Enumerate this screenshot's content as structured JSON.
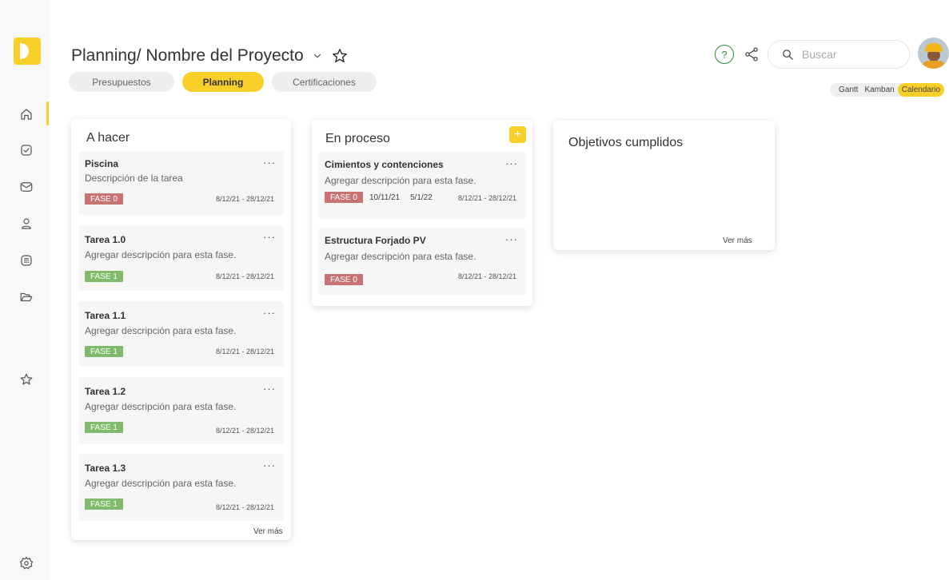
{
  "header": {
    "title": "Planning/ Nombre del Proyecto",
    "search_placeholder": "Buscar",
    "help_label": "?"
  },
  "tabs": [
    {
      "label": "Presupuestos",
      "active": false
    },
    {
      "label": "Planning",
      "active": true
    },
    {
      "label": "Certificaciones",
      "active": false
    }
  ],
  "views": [
    {
      "label": "Gantt",
      "active": false
    },
    {
      "label": "Kamban",
      "active": false
    },
    {
      "label": "Calendario",
      "active": true
    }
  ],
  "columns": {
    "todo": {
      "title": "A hacer",
      "ver_mas": "Ver más",
      "cards": [
        {
          "title": "Piscina",
          "desc": "Descripción de la tarea",
          "badge": "FASE 0",
          "dates": "8/12/21 - 28/12/21"
        },
        {
          "title": "Tarea 1.0",
          "desc": "Agregar descripción para esta fase.",
          "badge": "FASE 1",
          "dates": "8/12/21 - 28/12/21"
        },
        {
          "title": "Tarea 1.1",
          "desc": "Agregar descripción para esta fase.",
          "badge": "FASE 1",
          "dates": "8/12/21 - 28/12/21"
        },
        {
          "title": "Tarea 1.2",
          "desc": "Agregar descripción para esta fase.",
          "badge": "FASE 1",
          "dates": "8/12/21 - 28/12/21"
        },
        {
          "title": "Tarea 1.3",
          "desc": "Agregar descripción para esta fase.",
          "badge": "FASE 1",
          "dates": "8/12/21 - 28/12/21"
        }
      ]
    },
    "in_progress": {
      "title": "En proceso",
      "add_label": "+",
      "cards": [
        {
          "title": "Cimientos y contenciones",
          "desc": "Agregar descripción para esta fase.",
          "badge": "FASE 0",
          "date_a": "10/11/21",
          "date_b": "5/1/22",
          "dates": "8/12/21 - 28/12/21"
        },
        {
          "title": "Estructura Forjado PV",
          "desc": "Agregar descripción para esta fase.",
          "badge": "FASE 0",
          "dates": "8/12/21 - 28/12/21"
        }
      ]
    },
    "done": {
      "title": "Objetivos cumplidos",
      "ver_mas": "Ver más"
    }
  },
  "colors": {
    "accent": "#f9cf2a",
    "badge_red": "#c77373",
    "badge_green": "#7fbb6a",
    "help_green": "#2a8a3a"
  },
  "icons": {
    "sidebar": [
      "home-icon",
      "checkbox-icon",
      "mail-icon",
      "user-icon",
      "calculator-icon",
      "folder-icon",
      "star-icon",
      "settings-icon"
    ]
  }
}
